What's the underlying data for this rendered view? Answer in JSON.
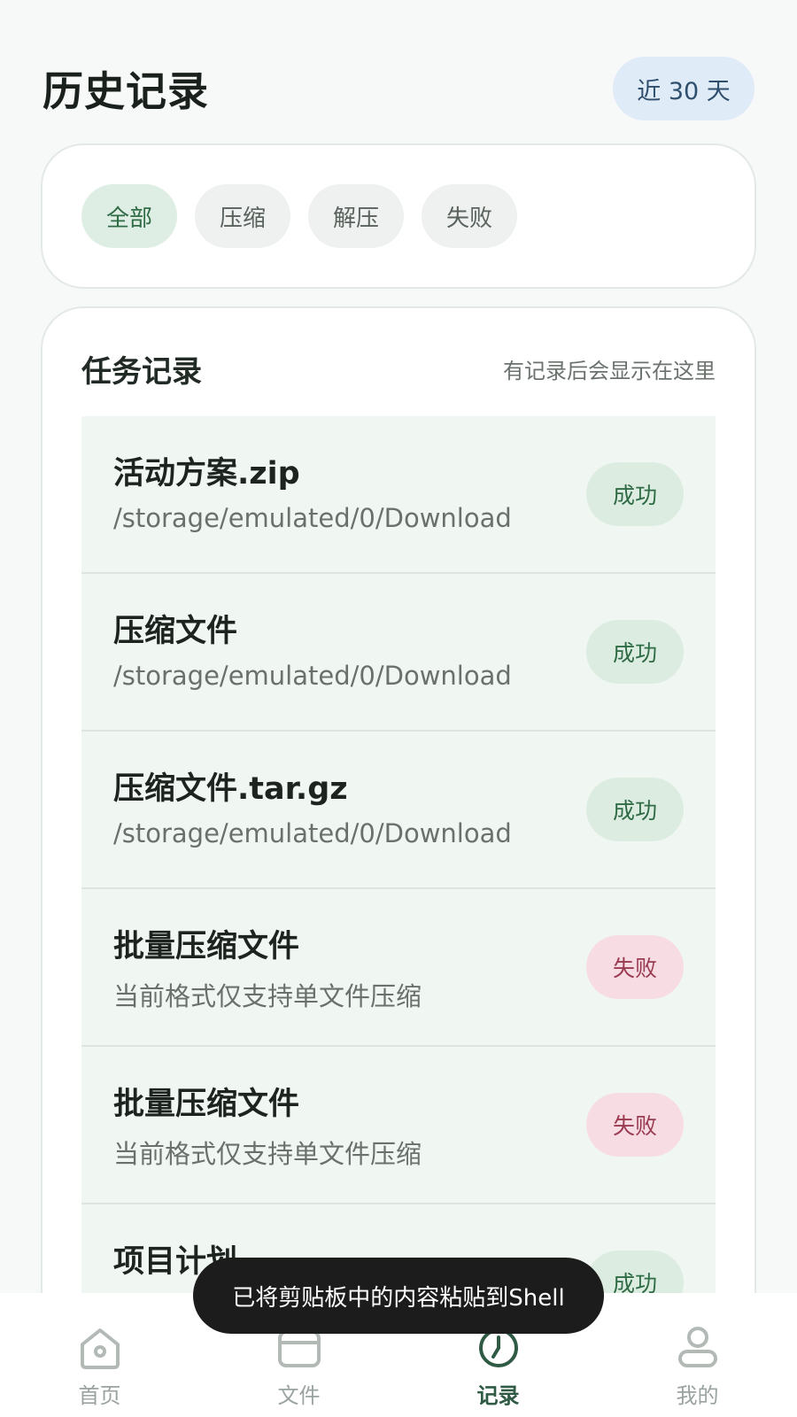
{
  "header": {
    "title": "历史记录",
    "range": "近 30 天"
  },
  "filters": [
    {
      "label": "全部",
      "active": true
    },
    {
      "label": "压缩",
      "active": false
    },
    {
      "label": "解压",
      "active": false
    },
    {
      "label": "失败",
      "active": false
    }
  ],
  "records": {
    "title": "任务记录",
    "hint": "有记录后会显示在这里",
    "items": [
      {
        "name": "活动方案.zip",
        "detail": "/storage/emulated/0/Download",
        "status": "成功",
        "state": "ok"
      },
      {
        "name": "压缩文件",
        "detail": "/storage/emulated/0/Download",
        "status": "成功",
        "state": "ok"
      },
      {
        "name": "压缩文件.tar.gz",
        "detail": "/storage/emulated/0/Download",
        "status": "成功",
        "state": "ok"
      },
      {
        "name": "批量压缩文件",
        "detail": "当前格式仅支持单文件压缩",
        "status": "失败",
        "state": "fail"
      },
      {
        "name": "批量压缩文件",
        "detail": "当前格式仅支持单文件压缩",
        "status": "失败",
        "state": "fail"
      },
      {
        "name": "项目计划",
        "detail": "",
        "status": "成功",
        "state": "ok"
      }
    ]
  },
  "toast": "已将剪贴板中的内容粘贴到Shell",
  "nav": [
    {
      "label": "首页",
      "icon": "home-icon",
      "active": false
    },
    {
      "label": "文件",
      "icon": "folder-icon",
      "active": false
    },
    {
      "label": "记录",
      "icon": "clock-icon",
      "active": true
    },
    {
      "label": "我的",
      "icon": "person-icon",
      "active": false
    }
  ],
  "colors": {
    "accent": "#2f5a44",
    "success_bg": "#dcece1",
    "fail_bg": "#f7dde3",
    "range_bg": "#dfebf7"
  }
}
